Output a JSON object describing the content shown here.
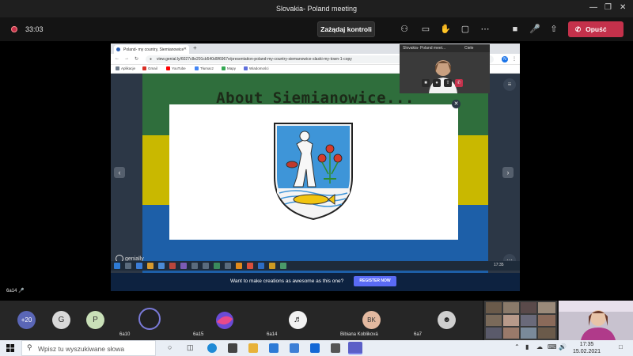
{
  "window": {
    "title": "Slovakia- Poland meeting"
  },
  "toolbar": {
    "timer": "33:03",
    "request_control_label": "Zażądaj kontroli",
    "leave_label": "Opuść"
  },
  "browser": {
    "tab_title": "Poland- my country, Siemianowice",
    "url": "view.genial.ly/6027c8e291cb540d9f6967e/presentation-poland-my-country-siemanowice-slaski-my-town-1-copy",
    "profile_initial": "N",
    "bookmarks": [
      {
        "label": "Aplikacje",
        "color": "#6f7b8a"
      },
      {
        "label": "Gmail",
        "color": "#d93025"
      },
      {
        "label": "YouTube",
        "color": "#ff0000"
      },
      {
        "label": "Tłumacz",
        "color": "#4285f4"
      },
      {
        "label": "Mapy",
        "color": "#34a853"
      },
      {
        "label": "Wiadomości",
        "color": "#5f6fdc"
      }
    ],
    "clock": "17:35"
  },
  "presentation": {
    "slide_title": "About Siemianowice...",
    "brand": "genially",
    "cta_text": "Want to make creations as awesome as this one?",
    "cta_button": "REGISTER NOW",
    "band_colors": [
      "#2f6e3c",
      "#c9b800",
      "#1d5fa8"
    ]
  },
  "selfview": {
    "title": "Slovakia- Poland meet...",
    "tag": "Ciele"
  },
  "stage_participant": {
    "label": "6a14"
  },
  "participants": {
    "overflow_count": "+20",
    "avatars": [
      {
        "initial": "G",
        "color": "#d8d8d8"
      },
      {
        "initial": "P",
        "color": "#c9e0b8"
      }
    ],
    "tiles": [
      {
        "label": "6a10"
      },
      {
        "label": "6a15"
      },
      {
        "label": "6a14"
      },
      {
        "label": "Bibiana Kobliková",
        "initials": "BK"
      },
      {
        "label": "6a7"
      }
    ]
  },
  "taskbar": {
    "search_placeholder": "Wpisz tu wyszukiwane słowa",
    "time": "17:35",
    "date": "15.02.2021"
  }
}
